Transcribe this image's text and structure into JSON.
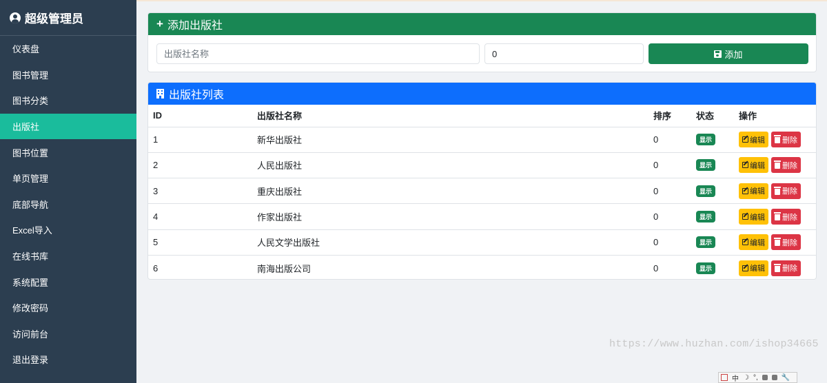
{
  "sidebar": {
    "brand": "超级管理员",
    "items": [
      {
        "label": "仪表盘"
      },
      {
        "label": "图书管理"
      },
      {
        "label": "图书分类"
      },
      {
        "label": "出版社",
        "active": true
      },
      {
        "label": "图书位置"
      },
      {
        "label": "单页管理"
      },
      {
        "label": "底部导航"
      },
      {
        "label": "Excel导入"
      },
      {
        "label": "在线书库"
      },
      {
        "label": "系统配置"
      },
      {
        "label": "修改密码"
      },
      {
        "label": "访问前台"
      },
      {
        "label": "退出登录"
      }
    ]
  },
  "add_card": {
    "title": "添加出版社",
    "name_placeholder": "出版社名称",
    "sort_value": "0",
    "add_label": "添加"
  },
  "list_card": {
    "title": "出版社列表",
    "headers": {
      "id": "ID",
      "name": "出版社名称",
      "sort": "排序",
      "status": "状态",
      "actions": "操作"
    },
    "rows": [
      {
        "id": "1",
        "name": "新华出版社",
        "sort": "0",
        "status": "显示"
      },
      {
        "id": "2",
        "name": "人民出版社",
        "sort": "0",
        "status": "显示"
      },
      {
        "id": "3",
        "name": "重庆出版社",
        "sort": "0",
        "status": "显示"
      },
      {
        "id": "4",
        "name": "作家出版社",
        "sort": "0",
        "status": "显示"
      },
      {
        "id": "5",
        "name": "人民文学出版社",
        "sort": "0",
        "status": "显示"
      },
      {
        "id": "6",
        "name": "南海出版公司",
        "sort": "0",
        "status": "显示"
      }
    ],
    "edit_label": "编辑",
    "delete_label": "删除"
  },
  "watermark": "https://www.huzhan.com/ishop34665",
  "ime_bar": {
    "mode": "中",
    "punct": "°,"
  },
  "colors": {
    "sidebar": "#2c3e50",
    "active": "#1abc9c",
    "add_header": "#198754",
    "list_header": "#0d6efd",
    "edit": "#ffc107",
    "delete": "#dc3545"
  }
}
